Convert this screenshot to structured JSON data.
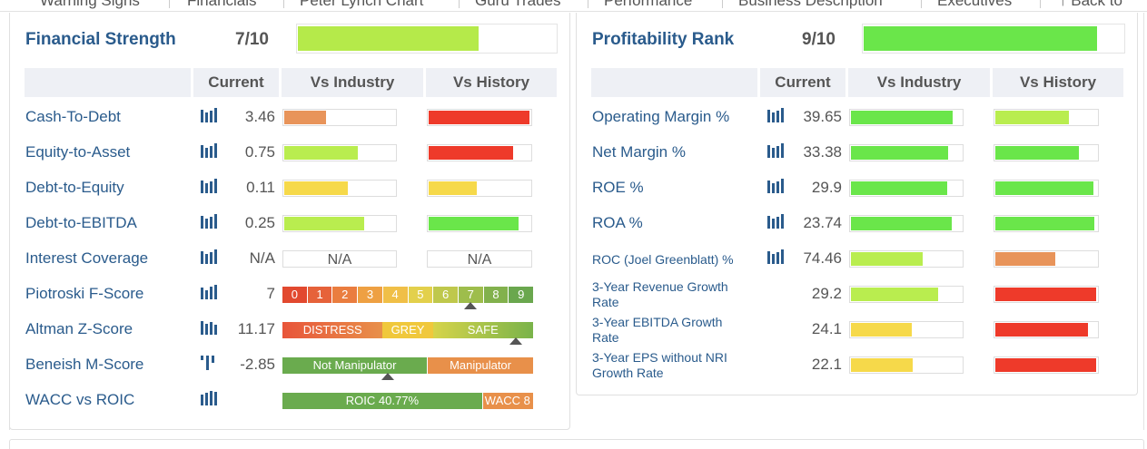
{
  "nav": {
    "tabs": [
      "Warning Signs",
      "Financials",
      "Peter Lynch Chart",
      "Guru Trades",
      "Performance",
      "Business Description",
      "Executives",
      "Back to"
    ]
  },
  "financial_strength": {
    "title": "Financial Strength",
    "score": "7/10",
    "score_fraction": 0.7,
    "bar_color": "#b5ea4a",
    "headers": {
      "current": "Current",
      "vs_industry": "Vs Industry",
      "vs_history": "Vs History"
    },
    "rows": [
      {
        "label": "Cash-To-Debt",
        "value": "3.46",
        "industry": 0.38,
        "industry_color": "#e8945a",
        "history": 0.99,
        "history_color": "#ee3a2a"
      },
      {
        "label": "Equity-to-Asset",
        "value": "0.75",
        "industry": 0.66,
        "industry_color": "#b9ed4f",
        "history": 0.83,
        "history_color": "#ee3a2a"
      },
      {
        "label": "Debt-to-Equity",
        "value": "0.11",
        "industry": 0.57,
        "industry_color": "#f6d94a",
        "history": 0.47,
        "history_color": "#f6d94a"
      },
      {
        "label": "Debt-to-EBITDA",
        "value": "0.25",
        "industry": 0.72,
        "industry_color": "#b9ed4f",
        "history": 0.88,
        "history_color": "#6ae64a"
      },
      {
        "label": "Interest Coverage",
        "value": "N/A",
        "industry_text": "N/A",
        "history_text": "N/A"
      }
    ],
    "piotroski": {
      "label": "Piotroski F-Score",
      "value": "7",
      "scale": [
        "0",
        "1",
        "2",
        "3",
        "4",
        "5",
        "6",
        "7",
        "8",
        "9"
      ],
      "marker_fraction": 0.75
    },
    "altman": {
      "label": "Altman Z-Score",
      "value": "11.17",
      "segments": [
        "DISTRESS",
        "GREY",
        "SAFE"
      ],
      "marker_fraction": 0.93
    },
    "beneish": {
      "label": "Beneish M-Score",
      "value": "-2.85",
      "segments": [
        "Not Manipulator",
        "Manipulator"
      ],
      "marker_fraction": 0.42
    },
    "wacc": {
      "label": "WACC vs ROIC",
      "roic_text": "ROIC 40.77%",
      "wacc_text": "WACC 8"
    }
  },
  "profitability": {
    "title": "Profitability Rank",
    "score": "9/10",
    "score_fraction": 0.9,
    "bar_color": "#6ae64a",
    "headers": {
      "current": "Current",
      "vs_industry": "Vs Industry",
      "vs_history": "Vs History"
    },
    "rows": [
      {
        "label": "Operating Margin %",
        "value": "39.65",
        "industry": 0.92,
        "industry_color": "#6ae64a",
        "history": 0.72,
        "history_color": "#b9ed4f",
        "icon": true
      },
      {
        "label": "Net Margin %",
        "value": "33.38",
        "industry": 0.88,
        "industry_color": "#6ae64a",
        "history": 0.82,
        "history_color": "#6ae64a",
        "icon": true
      },
      {
        "label": "ROE %",
        "value": "29.9",
        "industry": 0.87,
        "industry_color": "#6ae64a",
        "history": 0.96,
        "history_color": "#6ae64a",
        "icon": true
      },
      {
        "label": "ROA %",
        "value": "23.74",
        "industry": 0.91,
        "industry_color": "#6ae64a",
        "history": 0.97,
        "history_color": "#6ae64a",
        "icon": true
      },
      {
        "label": "ROC (Joel Greenblatt) %",
        "value": "74.46",
        "industry": 0.65,
        "industry_color": "#b9ed4f",
        "history": 0.59,
        "history_color": "#e8945a",
        "icon": true,
        "small": true
      },
      {
        "label": "3-Year Revenue Growth Rate",
        "value": "29.2",
        "industry": 0.79,
        "industry_color": "#b9ed4f",
        "history": 0.99,
        "history_color": "#ee3a2a",
        "icon": false,
        "small": true
      },
      {
        "label": "3-Year EBITDA Growth Rate",
        "value": "24.1",
        "industry": 0.55,
        "industry_color": "#f6d94a",
        "history": 0.91,
        "history_color": "#ee3a2a",
        "icon": false,
        "small": true
      },
      {
        "label": "3-Year EPS without NRI Growth Rate",
        "value": "22.1",
        "industry": 0.56,
        "industry_color": "#f6d94a",
        "history": 0.99,
        "history_color": "#ee3a2a",
        "icon": false,
        "small": true
      }
    ]
  }
}
